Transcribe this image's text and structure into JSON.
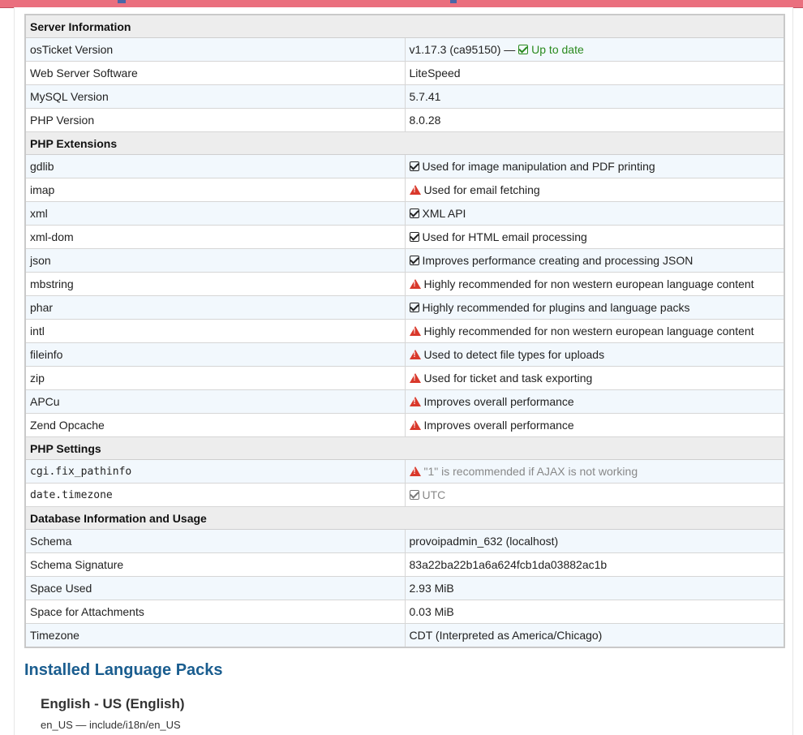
{
  "server": {
    "title": "Server Information",
    "rows": [
      {
        "key": "osTicket Version",
        "value": "v1.17.3 (ca95150) —",
        "status": "Up to date"
      },
      {
        "key": "Web Server Software",
        "value": "LiteSpeed"
      },
      {
        "key": "MySQL Version",
        "value": "5.7.41"
      },
      {
        "key": "PHP Version",
        "value": "8.0.28"
      }
    ]
  },
  "extensions": {
    "title": "PHP Extensions",
    "rows": [
      {
        "key": "gdlib",
        "icon": "check-icon",
        "value": "Used for image manipulation and PDF printing"
      },
      {
        "key": "imap",
        "icon": "warning-icon",
        "value": "Used for email fetching"
      },
      {
        "key": "xml",
        "icon": "check-icon",
        "value": "XML API"
      },
      {
        "key": "xml-dom",
        "icon": "check-icon",
        "value": "Used for HTML email processing"
      },
      {
        "key": "json",
        "icon": "check-icon",
        "value": "Improves performance creating and processing JSON"
      },
      {
        "key": "mbstring",
        "icon": "warning-icon",
        "value": "Highly recommended for non western european language content"
      },
      {
        "key": "phar",
        "icon": "check-icon",
        "value": "Highly recommended for plugins and language packs"
      },
      {
        "key": "intl",
        "icon": "warning-icon",
        "value": "Highly recommended for non western european language content"
      },
      {
        "key": "fileinfo",
        "icon": "warning-icon",
        "value": "Used to detect file types for uploads"
      },
      {
        "key": "zip",
        "icon": "warning-icon",
        "value": "Used for ticket and task exporting"
      },
      {
        "key": "APCu",
        "icon": "warning-icon",
        "value": "Improves overall performance"
      },
      {
        "key": "Zend Opcache",
        "icon": "warning-icon",
        "value": "Improves overall performance"
      }
    ]
  },
  "settings": {
    "title": "PHP Settings",
    "rows": [
      {
        "key": "cgi.fix_pathinfo",
        "icon": "warning-icon",
        "value": "\"1\" is recommended if AJAX is not working"
      },
      {
        "key": "date.timezone",
        "icon": "check-icon",
        "value": "UTC"
      }
    ]
  },
  "database": {
    "title": "Database Information and Usage",
    "rows": [
      {
        "key": "Schema",
        "value": "provoipadmin_632 (localhost)"
      },
      {
        "key": "Schema Signature",
        "value": "83a22ba22b1a6a624fcb1da03882ac1b"
      },
      {
        "key": "Space Used",
        "value": "2.93 MiB"
      },
      {
        "key": "Space for Attachments",
        "value": "0.03 MiB"
      },
      {
        "key": "Timezone",
        "value": "CDT (Interpreted as America/Chicago)"
      }
    ]
  },
  "language_packs": {
    "heading": "Installed Language Packs",
    "items": [
      {
        "name": "English - US (English)",
        "path": "en_US — include/i18n/en_US"
      }
    ]
  },
  "colors": {
    "link_heading": "#1a5d8f",
    "ok_green": "#2a8a1e",
    "warning_red": "#d9382b",
    "row_alt": "#f2f8fd",
    "section_bg": "#ededed"
  }
}
